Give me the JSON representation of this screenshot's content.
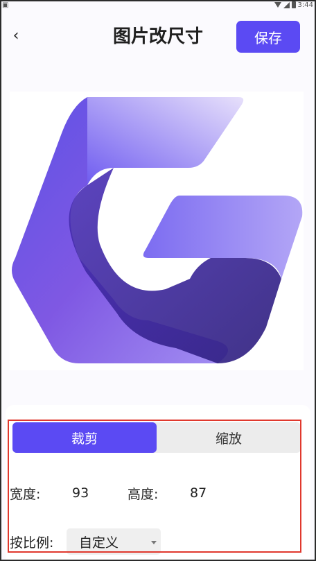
{
  "status_bar": {
    "time": "3:44"
  },
  "header": {
    "back_icon": "chevron-left-icon",
    "title": "图片改尺寸",
    "save_label": "保存"
  },
  "colors": {
    "accent": "#5b4af3",
    "highlight": "#e0382d",
    "segment_bg": "#ececec"
  },
  "tabs": [
    {
      "label": "裁剪",
      "active": true
    },
    {
      "label": "缩放",
      "active": false
    }
  ],
  "dimensions": {
    "width_label": "宽度:",
    "width_value": "93",
    "height_label": "高度:",
    "height_value": "87"
  },
  "ratio": {
    "label": "按比例:",
    "selected": "自定义"
  }
}
